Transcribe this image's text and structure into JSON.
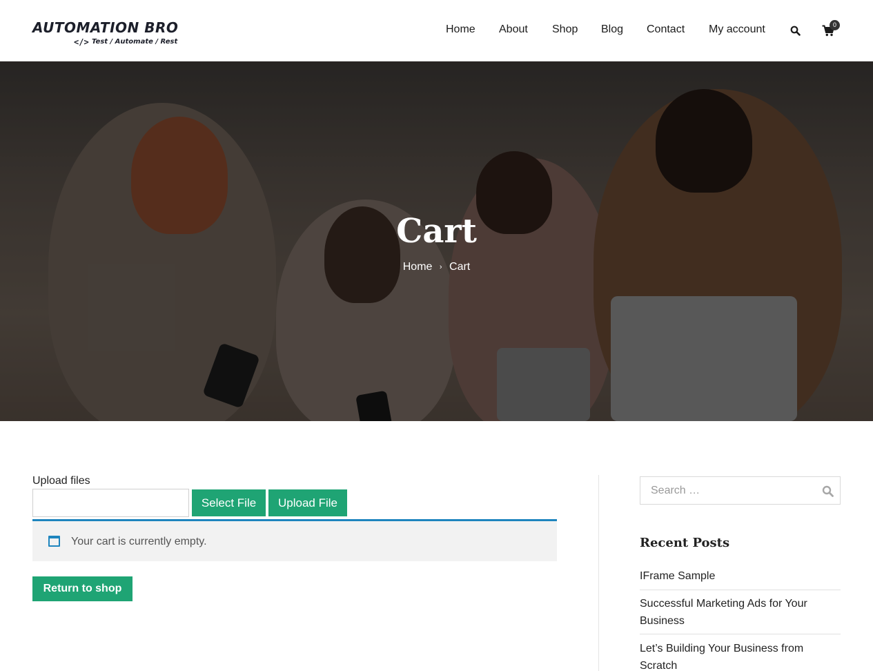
{
  "logo": {
    "title": "AUTOMATION BRO",
    "code_symbol": "</>",
    "tagline": "Test / Automate / Rest"
  },
  "nav": {
    "items": [
      "Home",
      "About",
      "Shop",
      "Blog",
      "Contact",
      "My account"
    ],
    "search_icon": "search-icon",
    "cart_icon": "cart-icon",
    "cart_count": "0"
  },
  "hero": {
    "title": "Cart",
    "breadcrumb": {
      "home": "Home",
      "separator": "›",
      "current": "Cart"
    }
  },
  "upload": {
    "label": "Upload files",
    "select_button": "Select File",
    "upload_button": "Upload File"
  },
  "notice": {
    "icon": "window-icon",
    "text": "Your cart is currently empty."
  },
  "return_button": "Return to shop",
  "sidebar": {
    "search_placeholder": "Search …",
    "recent_posts_title": "Recent Posts",
    "recent_posts": [
      "IFrame Sample",
      "Successful Marketing Ads for Your Business",
      "Let’s Building Your Business from Scratch"
    ]
  },
  "colors": {
    "accent_green": "#1fa474",
    "info_blue": "#1e85be",
    "dark": "#1c1f2a"
  }
}
